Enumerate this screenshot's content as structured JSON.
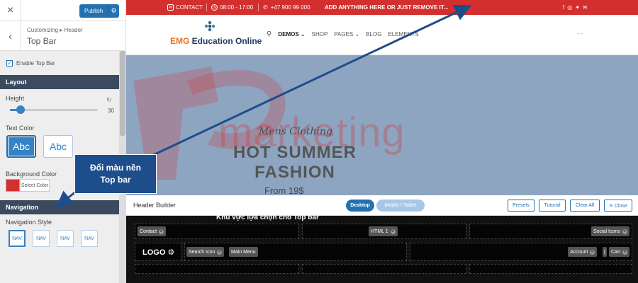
{
  "customizer": {
    "close_label": "×",
    "publish_label": "Publish",
    "back_label": "‹",
    "breadcrumb": "Customizing ▸ Header",
    "section_title": "Top Bar",
    "enable_label": "Enable Top Bar",
    "enable_checked": true,
    "layout_heading": "Layout",
    "height_label": "Height",
    "height_value": "30",
    "height_fraction": 0.12,
    "text_color_label": "Text Color",
    "text_color_options": [
      "Abc",
      "Abc"
    ],
    "bg_color_label": "Background Color",
    "bg_color_value": "#d32f2f",
    "select_color_label": "Select Color",
    "navigation_heading": "Navigation",
    "nav_style_label": "Navigation Style",
    "nav_style_options": [
      "NAV",
      "NAV",
      "NAV",
      "NAV"
    ]
  },
  "topbar": {
    "contact": "CONTACT",
    "hours": "08:00 - 17:00",
    "phone": "+47 900 99 000",
    "message": "ADD ANYTHING HERE OR JUST REMOVE IT...",
    "social_icons": [
      "facebook-icon",
      "instagram-icon",
      "twitter-icon",
      "mail-icon"
    ],
    "bg_color": "#d32f2f"
  },
  "site_header": {
    "logo_emg": "EMG",
    "logo_rest": " Education Online",
    "nav": [
      "DEMOS",
      "SHOP",
      "PAGES",
      "BLOG",
      "ELEMENTS"
    ],
    "dots": "-   -"
  },
  "hero": {
    "watermark": "marketing",
    "script": "Mens Clothing",
    "headline_1": "HOT SUMMER",
    "headline_2": "FASHION",
    "from": "From 19$"
  },
  "builder": {
    "title": "Header Builder",
    "tab_desktop": "Desktop",
    "tab_mobile": "Mobile / Tablet",
    "btn_presets": "Presets",
    "btn_tutorial": "Tutorial",
    "btn_clear": "Clear All",
    "btn_close": "✕ Close",
    "annotation": "Khu vực lựa chọn cho Top bar",
    "row1": {
      "left": "Contact",
      "center": "HTML 1",
      "right": "Social Icons"
    },
    "row2": {
      "logo": "LOGO",
      "search": "Search Icon",
      "menu": "Main Menu",
      "account": "Account",
      "sep": "|",
      "cart": "Cart"
    }
  },
  "callout": {
    "line1": "Đổi màu nền",
    "line2": "Top bar"
  }
}
